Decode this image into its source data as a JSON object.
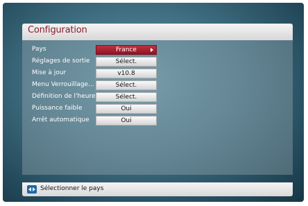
{
  "header": {
    "title": "Configuration"
  },
  "menu": {
    "items": [
      {
        "label": "Pays",
        "value": "France"
      },
      {
        "label": "Réglages de sortie",
        "value": "Sélect."
      },
      {
        "label": "Mise à jour",
        "value": "v10.8"
      },
      {
        "label": "Menu Verrouillage...",
        "value": "Sélect."
      },
      {
        "label": "Définition de l'heure...",
        "value": "Sélect."
      },
      {
        "label": "Puissance faible",
        "value": "Oui"
      },
      {
        "label": "Arrêt automatique",
        "value": "Oui"
      }
    ],
    "selected_index": 0
  },
  "footer": {
    "icon": "left-right-arrows-icon",
    "hint": "Sélectionner le pays"
  },
  "colors": {
    "title_text": "#8a1c2c",
    "selected_value_bg": "#b02535",
    "background": "#3e6d80",
    "nav_icon": "#1d68a8"
  }
}
